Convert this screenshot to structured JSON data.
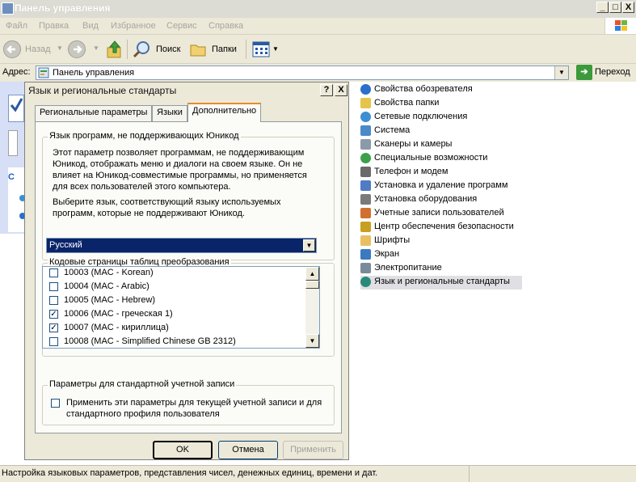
{
  "window": {
    "title": "Панель управления",
    "caption_buttons": {
      "minimize": "_",
      "maximize": "□",
      "close": "X"
    }
  },
  "menu": [
    "Файл",
    "Правка",
    "Вид",
    "Избранное",
    "Сервис",
    "Справка"
  ],
  "toolbar": {
    "back_label": "Назад",
    "search_label": "Поиск",
    "folders_label": "Папки"
  },
  "address": {
    "label": "Адрес:",
    "value": "Панель управления",
    "go_label": "Переход"
  },
  "control_panel_items": [
    {
      "label": "Свойства обозревателя",
      "icon": "internet-options-icon",
      "color": "#2a6fc9"
    },
    {
      "label": "Свойства папки",
      "icon": "folder-options-icon",
      "color": "#e6c34a"
    },
    {
      "label": "Сетевые подключения",
      "icon": "network-connections-icon",
      "color": "#3c8fd1"
    },
    {
      "label": "Система",
      "icon": "system-icon",
      "color": "#4a8ac8"
    },
    {
      "label": "Сканеры и камеры",
      "icon": "scanners-cameras-icon",
      "color": "#8a9aa8"
    },
    {
      "label": "Специальные возможности",
      "icon": "accessibility-icon",
      "color": "#3ca04a"
    },
    {
      "label": "Телефон и модем",
      "icon": "phone-modem-icon",
      "color": "#6a6a6a"
    },
    {
      "label": "Установка и удаление программ",
      "icon": "add-remove-programs-icon",
      "color": "#4f7cc4"
    },
    {
      "label": "Установка оборудования",
      "icon": "add-hardware-icon",
      "color": "#7a7a7a"
    },
    {
      "label": "Учетные записи пользователей",
      "icon": "user-accounts-icon",
      "color": "#d07030"
    },
    {
      "label": "Центр обеспечения безопасности",
      "icon": "security-center-icon",
      "color": "#c8a020"
    },
    {
      "label": "Шрифты",
      "icon": "fonts-icon",
      "color": "#e8c060"
    },
    {
      "label": "Экран",
      "icon": "display-icon",
      "color": "#3a7ac0"
    },
    {
      "label": "Электропитание",
      "icon": "power-options-icon",
      "color": "#7a8a9a"
    },
    {
      "label": "Язык и региональные стандарты",
      "icon": "regional-options-icon",
      "color": "#2a8a7a",
      "selected": true
    }
  ],
  "status_bar": {
    "text": "Настройка языковых параметров, представления чисел, денежных единиц, времени и дат."
  },
  "dialog": {
    "title": "Язык и региональные стандарты",
    "help_button": "?",
    "close_button": "X",
    "tabs": [
      {
        "label": "Региональные параметры",
        "active": false
      },
      {
        "label": "Языки",
        "active": false
      },
      {
        "label": "Дополнительно",
        "active": true
      }
    ],
    "non_unicode": {
      "title": "Язык программ, не поддерживающих Юникод",
      "description": "Этот параметр позволяет программам, не поддерживающим Юникод, отображать меню и диалоги на своем языке. Он не влияет на Юникод-совместимые программы, но применяется для всех пользователей этого компьютера.",
      "prompt": "Выберите язык, соответствующий языку используемых программ, которые не поддерживают Юникод.",
      "selected_language": "Русский"
    },
    "code_pages": {
      "title": "Кодовые страницы таблиц преобразования",
      "items": [
        {
          "label": "10003 (MAC - Korean)",
          "checked": false
        },
        {
          "label": "10004 (MAC - Arabic)",
          "checked": false
        },
        {
          "label": "10005 (MAC - Hebrew)",
          "checked": false
        },
        {
          "label": "10006 (MAC - греческая 1)",
          "checked": true
        },
        {
          "label": "10007 (MAC - кириллица)",
          "checked": true
        },
        {
          "label": "10008 (MAC - Simplified Chinese GB 2312)",
          "checked": false
        }
      ]
    },
    "default_account": {
      "title": "Параметры для стандартной учетной записи",
      "checkbox_label": "Применить эти параметры для текущей учетной записи и для стандартного профиля пользователя",
      "checked": false
    },
    "buttons": {
      "ok": "OK",
      "cancel": "Отмена",
      "apply": "Применить"
    }
  }
}
